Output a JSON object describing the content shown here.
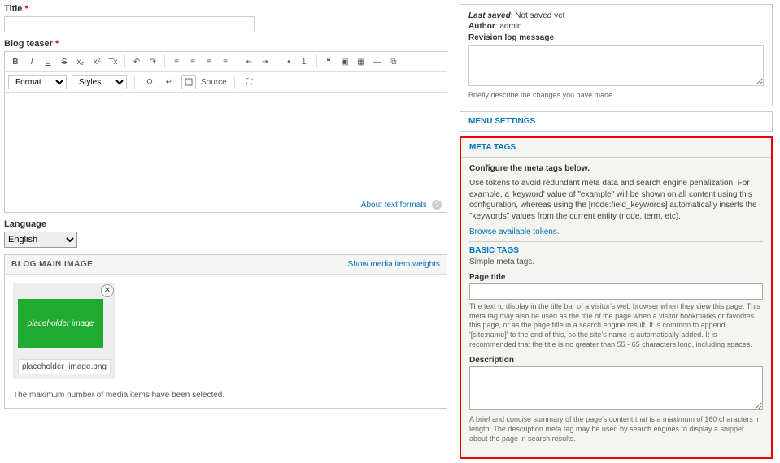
{
  "title": {
    "label": "Title",
    "value": ""
  },
  "teaser": {
    "label": "Blog teaser"
  },
  "toolbar": {
    "format_sel": "Format",
    "styles_sel": "Styles",
    "source": "Source",
    "icons": {
      "bold": "B",
      "italic": "I",
      "underline": "U",
      "strike": "S",
      "sub": "x₂",
      "super": "x²",
      "clear": "Tx",
      "undo": "↶",
      "redo": "↷",
      "align_l": "≡",
      "align_c": "≡",
      "align_r": "≡",
      "align_j": "≡",
      "outdent": "⇤",
      "indent": "⇥",
      "ul": "•",
      "ol": "1.",
      "quote": "❝",
      "image": "▣",
      "table": "▦",
      "hr": "—",
      "link": "⧉",
      "omega": "Ω",
      "break": "↵",
      "max": "⛶"
    }
  },
  "text_formats": "About text formats",
  "language": {
    "label": "Language",
    "value": "English"
  },
  "blog_image": {
    "title": "BLOG MAIN IMAGE",
    "show_weights": "Show media item weights",
    "thumb_text": "placeholder image",
    "caption": "placeholder_image.png",
    "max_note": "The maximum number of media items have been selected."
  },
  "revision": {
    "last_saved_label": "Last saved",
    "last_saved_value": "Not saved yet",
    "author_label": "Author",
    "author_value": "admin",
    "log_label": "Revision log message",
    "log_help": "Briefly describe the changes you have made."
  },
  "menu_settings": "MENU SETTINGS",
  "meta": {
    "title": "META TAGS",
    "configure": "Configure the meta tags below.",
    "intro": "Use tokens to avoid redundant meta data and search engine penalization. For example, a 'keyword' value of \"example\" will be shown on all content using this configuration, whereas using the [node:field_keywords] automatically inserts the \"keywords\" values from the current entity (node, term, etc).",
    "browse": "Browse available tokens.",
    "basic_title": "BASIC TAGS",
    "basic_desc": "Simple meta tags.",
    "page_title_label": "Page title",
    "page_title_help": "The text to display in the title bar of a visitor's web browser when they view this page. This meta tag may also be used as the title of the page when a visitor bookmarks or favorites this page, or as the page title in a search engine result. It is common to append '[site:name]' to the end of this, so the site's name is automatically added. It is recommended that the title is no greater than 55 - 65 characters long, including spaces.",
    "desc_label": "Description",
    "desc_help": "A brief and concise summary of the page's content that is a maximum of 160 characters in length. The description meta tag may be used by search engines to display a snippet about the page in search results."
  }
}
